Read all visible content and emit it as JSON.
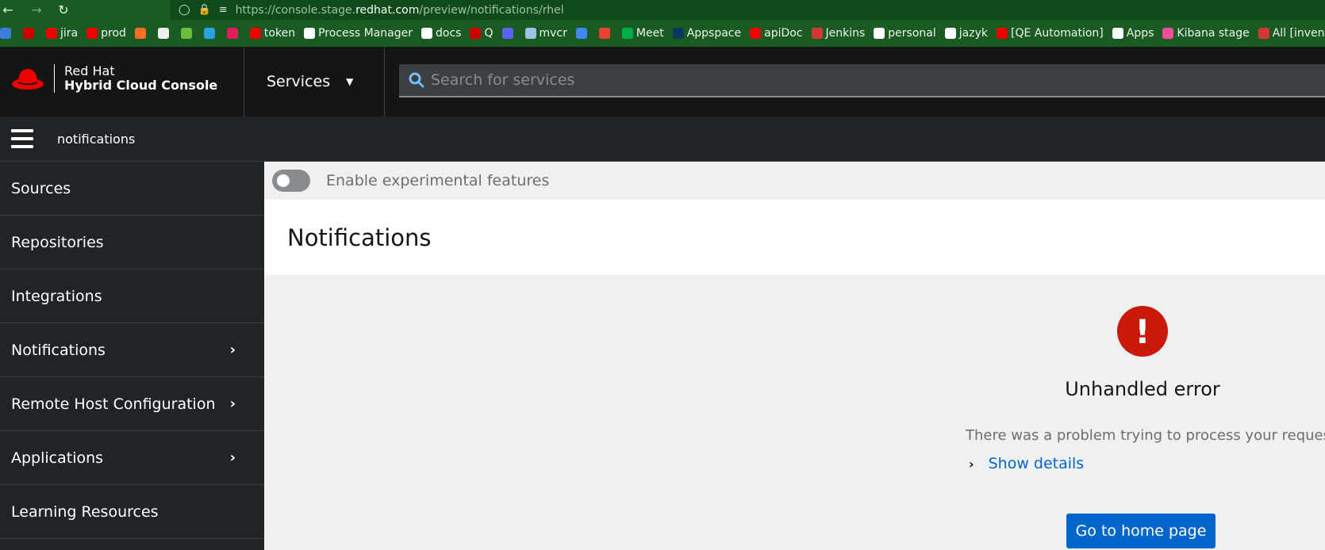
{
  "browser": {
    "url_prefix": "https://console.stage.",
    "url_domain": "redhat.com",
    "url_path": "/preview/notifications/rhel",
    "back_icon": "arrow-left-icon",
    "forward_icon": "arrow-right-icon",
    "reload_icon": "reload-icon"
  },
  "bookmarks": [
    {
      "label": "",
      "color": "#3b7dd8"
    },
    {
      "label": "",
      "color": "#cc0000"
    },
    {
      "label": "jira",
      "color": "#ee0000"
    },
    {
      "label": "prod",
      "color": "#ee0000"
    },
    {
      "label": "",
      "color": "#fc6d26"
    },
    {
      "label": "",
      "color": "#eeeeee"
    },
    {
      "label": "",
      "color": "#6bbd3a"
    },
    {
      "label": "",
      "color": "#2aa3e0"
    },
    {
      "label": "",
      "color": "#e01e5a"
    },
    {
      "label": "token",
      "color": "#ee0000"
    },
    {
      "label": "Process Manager",
      "color": "#ffffff"
    },
    {
      "label": "docs",
      "color": "#ffffff"
    },
    {
      "label": "Q",
      "color": "#cc0000"
    },
    {
      "label": "",
      "color": "#5865f2"
    },
    {
      "label": "mvcr",
      "color": "#9cc2e5"
    },
    {
      "label": "",
      "color": "#4285f4"
    },
    {
      "label": "",
      "color": "#ea4335"
    },
    {
      "label": "Meet",
      "color": "#00ac47"
    },
    {
      "label": "Appspace",
      "color": "#0b3a5c"
    },
    {
      "label": "apiDoc",
      "color": "#ee0000"
    },
    {
      "label": "Jenkins",
      "color": "#d33833"
    },
    {
      "label": "personal",
      "color": "#ffffff"
    },
    {
      "label": "jazyk",
      "color": "#ffffff"
    },
    {
      "label": "[QE Automation]",
      "color": "#ee0000"
    },
    {
      "label": "Apps",
      "color": "#ffffff"
    },
    {
      "label": "Kibana stage",
      "color": "#f04e98"
    },
    {
      "label": "All [inventory",
      "color": "#d33833"
    }
  ],
  "masthead": {
    "brand_line1": "Red Hat",
    "brand_line2": "Hybrid Cloud Console",
    "services_label": "Services",
    "search_placeholder": "Search for services"
  },
  "subheader": {
    "breadcrumb": "notifications"
  },
  "sidebar": {
    "items": [
      {
        "label": "Sources",
        "has_children": false
      },
      {
        "label": "Repositories",
        "has_children": false
      },
      {
        "label": "Integrations",
        "has_children": false
      },
      {
        "label": "Notifications",
        "has_children": true
      },
      {
        "label": "Remote Host Configuration",
        "has_children": true
      },
      {
        "label": "Applications",
        "has_children": true
      },
      {
        "label": "Learning Resources",
        "has_children": false
      }
    ]
  },
  "main": {
    "experimental_label": "Enable experimental features",
    "experimental_enabled": false,
    "page_title": "Notifications",
    "error": {
      "icon": "exclamation-circle-icon",
      "title": "Unhandled error",
      "message": "There was a problem trying to process your request.",
      "details_link": "Show details",
      "home_button": "Go to home page"
    }
  }
}
